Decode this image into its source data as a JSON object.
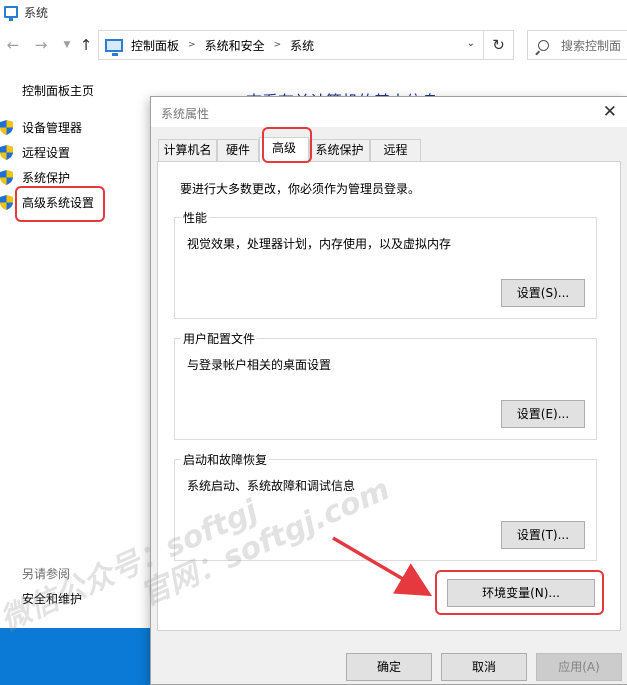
{
  "window": {
    "title": "系统"
  },
  "address": {
    "crumbs": [
      "控制面板",
      "系统和安全",
      "系统"
    ],
    "search_placeholder": "搜索控制面"
  },
  "left_pane": {
    "home": "控制面板主页",
    "items": [
      "设备管理器",
      "远程设置",
      "系统保护",
      "高级系统设置"
    ],
    "see_also": "另请参阅",
    "security": "安全和维护"
  },
  "main": {
    "heading": "查看有关计算机的基本信息"
  },
  "dialog": {
    "title": "系统属性",
    "tabs": [
      "计算机名",
      "硬件",
      "高级",
      "系统保护",
      "远程"
    ],
    "active_tab": "高级",
    "admin_note": "要进行大多数更改，你必须作为管理员登录。",
    "performance": {
      "title": "性能",
      "desc": "视觉效果，处理器计划，内存使用，以及虚拟内存",
      "button": "设置(S)..."
    },
    "profiles": {
      "title": "用户配置文件",
      "desc": "与登录帐户相关的桌面设置",
      "button": "设置(E)..."
    },
    "startup": {
      "title": "启动和故障恢复",
      "desc": "系统启动、系统故障和调试信息",
      "button": "设置(T)..."
    },
    "env_button": "环境变量(N)...",
    "ok": "确定",
    "cancel": "取消",
    "apply": "应用(A)"
  },
  "watermarks": {
    "wechat": "微信公众号：softgj",
    "site": "官网：softgj.com"
  },
  "colors": {
    "highlight": "#e5383f",
    "link_blue": "#1e3287",
    "taskbar": "#0a7ad6",
    "dialog_bg": "#f0f0f0"
  }
}
